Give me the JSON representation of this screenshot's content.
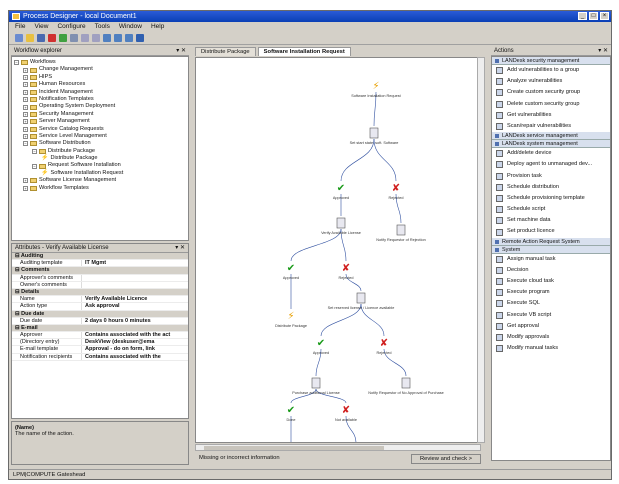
{
  "window": {
    "title": "Process Designer - local Document1"
  },
  "menu": [
    "File",
    "View",
    "Configure",
    "Tools",
    "Window",
    "Help"
  ],
  "left": {
    "tree_header": "Workflow explorer",
    "tree": [
      {
        "label": "Workflows",
        "depth": 0,
        "type": "folder"
      },
      {
        "label": "Change Management",
        "depth": 1,
        "type": "folder"
      },
      {
        "label": "HIPS",
        "depth": 1,
        "type": "folder"
      },
      {
        "label": "Human Resources",
        "depth": 1,
        "type": "folder"
      },
      {
        "label": "Incident Management",
        "depth": 1,
        "type": "folder"
      },
      {
        "label": "Notification Templates",
        "depth": 1,
        "type": "folder"
      },
      {
        "label": "Operating System Deployment",
        "depth": 1,
        "type": "folder"
      },
      {
        "label": "Security Management",
        "depth": 1,
        "type": "folder"
      },
      {
        "label": "Server Management",
        "depth": 1,
        "type": "folder"
      },
      {
        "label": "Service Catalog Requests",
        "depth": 1,
        "type": "folder"
      },
      {
        "label": "Service Level Management",
        "depth": 1,
        "type": "folder"
      },
      {
        "label": "Software Distribution",
        "depth": 1,
        "type": "folder"
      },
      {
        "label": "Distribute Package",
        "depth": 2,
        "type": "folder"
      },
      {
        "label": "Distribute Package",
        "depth": 3,
        "type": "workflow"
      },
      {
        "label": "Request Software Installation",
        "depth": 2,
        "type": "folder"
      },
      {
        "label": "Software Installation Request",
        "depth": 3,
        "type": "workflow"
      },
      {
        "label": "Software License Management",
        "depth": 1,
        "type": "folder"
      },
      {
        "label": "Workflow Templates",
        "depth": 1,
        "type": "folder"
      }
    ],
    "props_header": "Attributes - Verify Available License",
    "props": [
      {
        "cat": "Auditing"
      },
      {
        "k": "Auditing template",
        "v": "IT Mgmt"
      },
      {
        "cat": "Comments"
      },
      {
        "k": "Approver's comments",
        "v": ""
      },
      {
        "k": "Owner's comments",
        "v": ""
      },
      {
        "cat": "Details"
      },
      {
        "k": "Name",
        "v": "Verify Available Licence"
      },
      {
        "k": "Action type",
        "v": "Ask approval"
      },
      {
        "cat": "Due date"
      },
      {
        "k": "Due date",
        "v": "2 days 0 hours 0 minutes"
      },
      {
        "cat": "E-mail"
      },
      {
        "k": "Approver",
        "v": "Contains associated with the act"
      },
      {
        "k": "(Directory entry)",
        "v": "DeskView (deskuser@ema"
      },
      {
        "k": "E-mail template",
        "v": "Approval - do on form, link"
      },
      {
        "k": "Notification recipients",
        "v": "Contains associated with the"
      }
    ],
    "desc_title": "(Name)",
    "desc_text": "The name of the action."
  },
  "center": {
    "tabs": [
      "Distribute Package",
      "Software Installation Request"
    ],
    "active_tab": 1,
    "status_text": "Missing or incorrect information",
    "review_button": "Review and check >"
  },
  "workflow": {
    "nodes": [
      {
        "id": "start",
        "label": "Software Installation Request",
        "kind": "start"
      },
      {
        "id": "n1",
        "label": "Set start state: soft. Software",
        "kind": "doc"
      },
      {
        "id": "n2",
        "label": "Approved",
        "kind": "check"
      },
      {
        "id": "n3",
        "label": "Rejected",
        "kind": "cross"
      },
      {
        "id": "n4",
        "label": "Verify Available License",
        "kind": "doc"
      },
      {
        "id": "n5",
        "label": "Notify Requestor of Rejection",
        "kind": "doc"
      },
      {
        "id": "n6",
        "label": "Approved",
        "kind": "check"
      },
      {
        "id": "n7",
        "label": "Rejected",
        "kind": "cross"
      },
      {
        "id": "n8",
        "label": "Distribute Package",
        "kind": "start"
      },
      {
        "id": "n9",
        "label": "Set reserved license / Licence available",
        "kind": "doc"
      },
      {
        "id": "n10",
        "label": "Approved",
        "kind": "check"
      },
      {
        "id": "n11",
        "label": "Rejected",
        "kind": "cross"
      },
      {
        "id": "n12",
        "label": "Purchase additional License",
        "kind": "doc"
      },
      {
        "id": "n13",
        "label": "Notify Requestor of No Approval of Purchase",
        "kind": "doc"
      },
      {
        "id": "n14",
        "label": "Done",
        "kind": "check"
      },
      {
        "id": "n15",
        "label": "Not available",
        "kind": "cross"
      },
      {
        "id": "n16",
        "label": "Distribute Package",
        "kind": "start"
      },
      {
        "id": "n17",
        "label": "Notify Requestor of License not available",
        "kind": "doc"
      }
    ]
  },
  "right": {
    "header": "Actions",
    "sections": [
      {
        "title": "LANDesk security management",
        "items": [
          "Add vulnerabilities to a group",
          "Analyze vulnerabilities",
          "Create custom security group",
          "Delete custom security group",
          "Get vulnerabilities",
          "Scan/repair vulnerabilities"
        ]
      },
      {
        "title": "LANDesk service management",
        "items": []
      },
      {
        "title": "LANDesk system management",
        "items": [
          "Add/delete device",
          "Deploy agent to unmanaged dev...",
          "Provision task",
          "Schedule distribution",
          "Schedule provisioning template",
          "Schedule script",
          "Set machine data",
          "Set product licence"
        ]
      },
      {
        "title": "Remote Action Request System",
        "items": []
      },
      {
        "title": "System",
        "items": [
          "Assign manual task",
          "Decision",
          "Execute cloud task",
          "Execute program",
          "Execute SQL",
          "Execute VB script",
          "Get approval",
          "Modify approvals",
          "Modify manual tasks"
        ]
      }
    ]
  },
  "status": {
    "text": "LPM|COMPUTE Gateshead"
  },
  "colors": {
    "title": "#0a3fb5",
    "check": "#1a9a1a",
    "cross": "#d02020",
    "bolt": "#e8a000",
    "edge": "#3050a0"
  }
}
